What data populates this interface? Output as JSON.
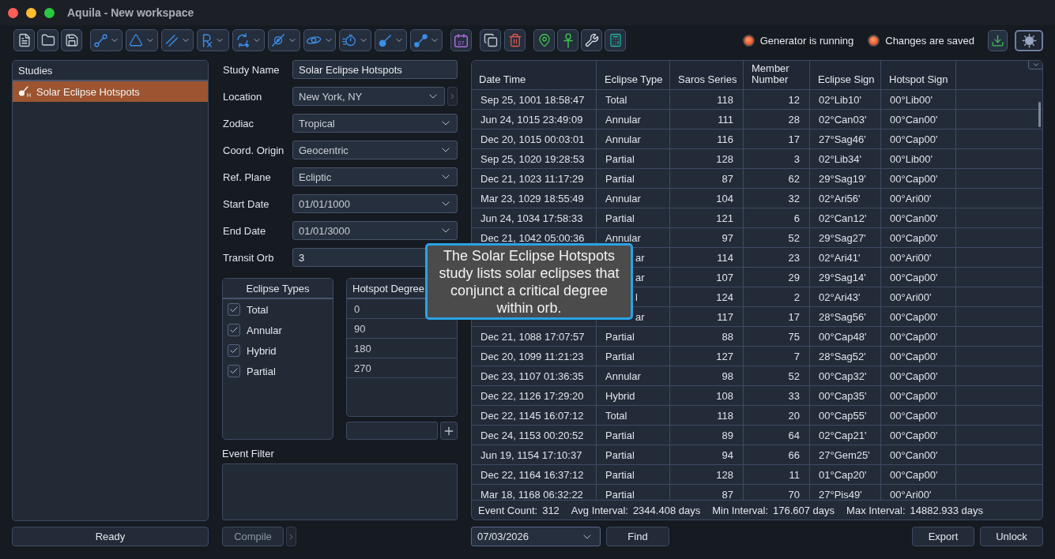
{
  "window": {
    "title": "Aquila - New workspace"
  },
  "toolbar": {
    "calendar_day": "07"
  },
  "status_indicators": [
    {
      "label": "Generator is running"
    },
    {
      "label": "Changes are saved"
    }
  ],
  "studies": {
    "title": "Studies",
    "items": [
      {
        "label": "Solar Eclipse Hotspots",
        "icon_mark": "H",
        "selected": true
      }
    ]
  },
  "status_button": {
    "label": "Ready"
  },
  "form": {
    "fields": [
      {
        "label": "Study Name",
        "kind": "text",
        "value": "Solar Eclipse Hotspots"
      },
      {
        "label": "Location",
        "kind": "select_more",
        "value": "New York, NY"
      },
      {
        "label": "Zodiac",
        "kind": "select",
        "value": "Tropical"
      },
      {
        "label": "Coord. Origin",
        "kind": "select",
        "value": "Geocentric"
      },
      {
        "label": "Ref. Plane",
        "kind": "select",
        "value": "Ecliptic"
      },
      {
        "label": "Start Date",
        "kind": "select",
        "value": "01/01/1000"
      },
      {
        "label": "End Date",
        "kind": "select",
        "value": "01/01/3000"
      },
      {
        "label": "Transit Orb",
        "kind": "text",
        "value": "3"
      }
    ]
  },
  "eclipse_types": {
    "title": "Eclipse Types",
    "items": [
      {
        "label": "Total",
        "checked": true
      },
      {
        "label": "Annular",
        "checked": true
      },
      {
        "label": "Hybrid",
        "checked": true
      },
      {
        "label": "Partial",
        "checked": true
      }
    ]
  },
  "hotspot_degrees": {
    "title": "Hotspot Degree",
    "values": [
      "0",
      "90",
      "180",
      "270"
    ]
  },
  "event_filter": {
    "label": "Event Filter"
  },
  "compile_button": {
    "label": "Compile",
    "disabled": true
  },
  "table": {
    "columns": [
      "Date Time",
      "Eclipse Type",
      "Saros Series",
      "Member Number",
      "Eclipse Sign",
      "Hotspot Sign"
    ],
    "rows": [
      {
        "date_time": "Sep 25, 1001 18:58:47",
        "eclipse_type": "Total",
        "saros_series": "118",
        "member_number": "12",
        "eclipse_sign": "02°Lib10'",
        "hotspot_sign": "00°Lib00'"
      },
      {
        "date_time": "Jun 24, 1015 23:49:09",
        "eclipse_type": "Annular",
        "saros_series": "111",
        "member_number": "28",
        "eclipse_sign": "02°Can03'",
        "hotspot_sign": "00°Can00'"
      },
      {
        "date_time": "Dec 20, 1015 00:03:01",
        "eclipse_type": "Annular",
        "saros_series": "116",
        "member_number": "17",
        "eclipse_sign": "27°Sag46'",
        "hotspot_sign": "00°Cap00'"
      },
      {
        "date_time": "Sep 25, 1020 19:28:53",
        "eclipse_type": "Partial",
        "saros_series": "128",
        "member_number": "3",
        "eclipse_sign": "02°Lib34'",
        "hotspot_sign": "00°Lib00'"
      },
      {
        "date_time": "Dec 21, 1023 11:17:29",
        "eclipse_type": "Partial",
        "saros_series": "87",
        "member_number": "62",
        "eclipse_sign": "29°Sag19'",
        "hotspot_sign": "00°Cap00'"
      },
      {
        "date_time": "Mar 23, 1029 18:55:49",
        "eclipse_type": "Annular",
        "saros_series": "104",
        "member_number": "32",
        "eclipse_sign": "02°Ari56'",
        "hotspot_sign": "00°Ari00'"
      },
      {
        "date_time": "Jun 24, 1034 17:58:33",
        "eclipse_type": "Partial",
        "saros_series": "121",
        "member_number": "6",
        "eclipse_sign": "02°Can12'",
        "hotspot_sign": "00°Can00'"
      },
      {
        "date_time": "Dec 21, 1042 05:00:36",
        "eclipse_type": "Annular",
        "saros_series": "97",
        "member_number": "52",
        "eclipse_sign": "29°Sag27'",
        "hotspot_sign": "00°Cap00'"
      },
      {
        "eclipse_type": "ar",
        "saros_series": "114",
        "member_number": "23",
        "eclipse_sign": "02°Ari41'",
        "hotspot_sign": "00°Ari00'"
      },
      {
        "eclipse_type": "ar",
        "saros_series": "107",
        "member_number": "29",
        "eclipse_sign": "29°Sag14'",
        "hotspot_sign": "00°Cap00'"
      },
      {
        "eclipse_type": "l",
        "saros_series": "124",
        "member_number": "2",
        "eclipse_sign": "02°Ari43'",
        "hotspot_sign": "00°Ari00'"
      },
      {
        "eclipse_type": "ar",
        "saros_series": "117",
        "member_number": "17",
        "eclipse_sign": "28°Sag56'",
        "hotspot_sign": "00°Cap00'"
      },
      {
        "date_time": "Dec 21, 1088 17:07:57",
        "eclipse_type": "Partial",
        "saros_series": "88",
        "member_number": "75",
        "eclipse_sign": "00°Cap48'",
        "hotspot_sign": "00°Cap00'"
      },
      {
        "date_time": "Dec 20, 1099 11:21:23",
        "eclipse_type": "Partial",
        "saros_series": "127",
        "member_number": "7",
        "eclipse_sign": "28°Sag52'",
        "hotspot_sign": "00°Cap00'"
      },
      {
        "date_time": "Dec 23, 1107 01:36:35",
        "eclipse_type": "Annular",
        "saros_series": "98",
        "member_number": "52",
        "eclipse_sign": "00°Cap32'",
        "hotspot_sign": "00°Cap00'"
      },
      {
        "date_time": "Dec 22, 1126 17:29:20",
        "eclipse_type": "Hybrid",
        "saros_series": "108",
        "member_number": "33",
        "eclipse_sign": "00°Cap35'",
        "hotspot_sign": "00°Cap00'"
      },
      {
        "date_time": "Dec 22, 1145 16:07:12",
        "eclipse_type": "Total",
        "saros_series": "118",
        "member_number": "20",
        "eclipse_sign": "00°Cap55'",
        "hotspot_sign": "00°Cap00'"
      },
      {
        "date_time": "Dec 24, 1153 00:20:52",
        "eclipse_type": "Partial",
        "saros_series": "89",
        "member_number": "64",
        "eclipse_sign": "02°Cap21'",
        "hotspot_sign": "00°Cap00'"
      },
      {
        "date_time": "Jun 19, 1154 17:10:37",
        "eclipse_type": "Partial",
        "saros_series": "94",
        "member_number": "66",
        "eclipse_sign": "27°Gem25'",
        "hotspot_sign": "00°Can00'"
      },
      {
        "date_time": "Dec 22, 1164 16:37:12",
        "eclipse_type": "Partial",
        "saros_series": "128",
        "member_number": "11",
        "eclipse_sign": "01°Cap20'",
        "hotspot_sign": "00°Cap00'"
      },
      {
        "date_time": "Mar 18, 1168 06:32:22",
        "eclipse_type": "Partial",
        "saros_series": "87",
        "member_number": "70",
        "eclipse_sign": "27°Pis49'",
        "hotspot_sign": "00°Ari00'"
      }
    ],
    "summary": [
      {
        "label": "Event Count:",
        "value": "312"
      },
      {
        "label": "Avg Interval:",
        "value": "2344.408 days"
      },
      {
        "label": "Min Interval:",
        "value": "176.607 days"
      },
      {
        "label": "Max Interval:",
        "value": "14882.933 days"
      }
    ]
  },
  "search": {
    "date": "07/03/2026",
    "button": "Find"
  },
  "buttons": [
    "Export",
    "Unlock"
  ],
  "tooltip": {
    "text": "The Solar Eclipse Hotspots study lists solar eclipses that conjunct a critical degree within orb."
  }
}
